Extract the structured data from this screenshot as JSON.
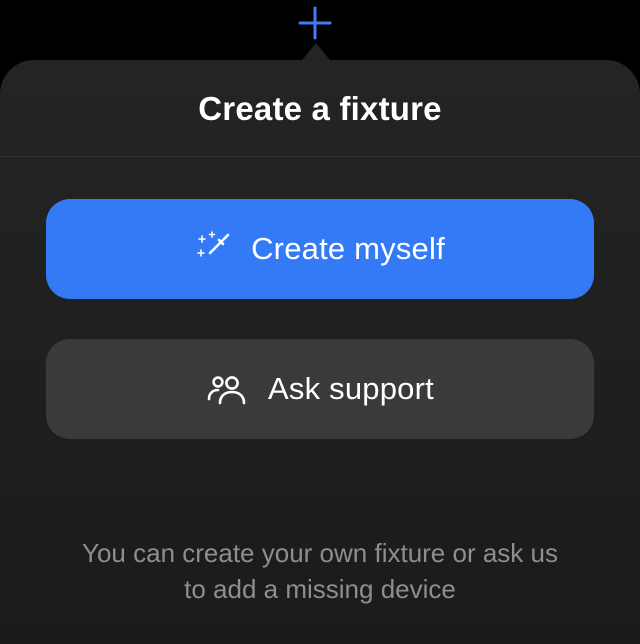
{
  "header": {
    "title": "Create a fixture"
  },
  "actions": {
    "primary_label": "Create myself",
    "secondary_label": "Ask support"
  },
  "description": "You can create your own fixture or ask us to add a missing device",
  "colors": {
    "primary": "#3479f6",
    "secondary_bg": "#3a3a3c",
    "popover_bg": "#232324"
  }
}
